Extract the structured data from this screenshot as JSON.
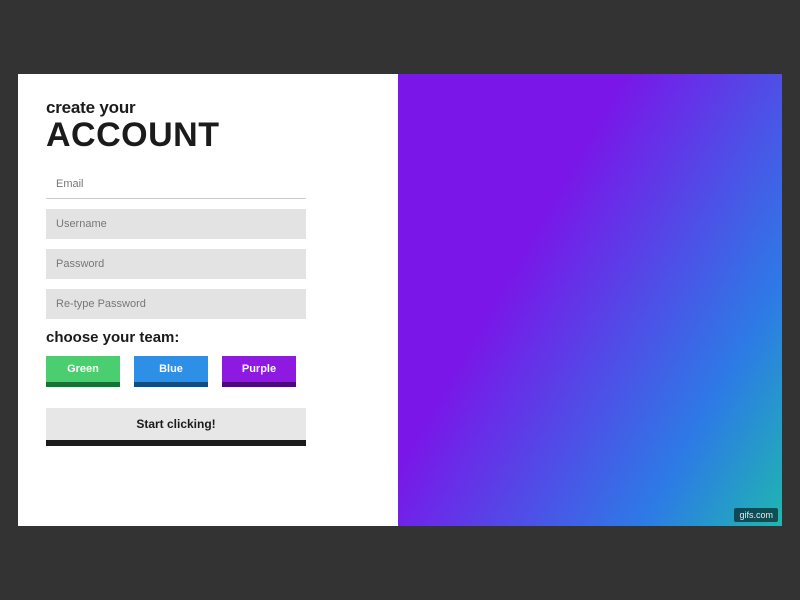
{
  "heading": {
    "line1": "create your",
    "line2": "ACCOUNT"
  },
  "fields": {
    "email": {
      "placeholder": "Email",
      "value": ""
    },
    "username": {
      "placeholder": "Username",
      "value": ""
    },
    "password": {
      "placeholder": "Password",
      "value": ""
    },
    "confirm": {
      "placeholder": "Re-type Password",
      "value": ""
    }
  },
  "team": {
    "label": "choose your team:",
    "options": {
      "green": {
        "label": "Green",
        "color": "#4bce6f"
      },
      "blue": {
        "label": "Blue",
        "color": "#2d8fe6"
      },
      "purple": {
        "label": "Purple",
        "color": "#8e19e0"
      }
    }
  },
  "submit_label": "Start clicking!",
  "watermark": "gifs.com"
}
